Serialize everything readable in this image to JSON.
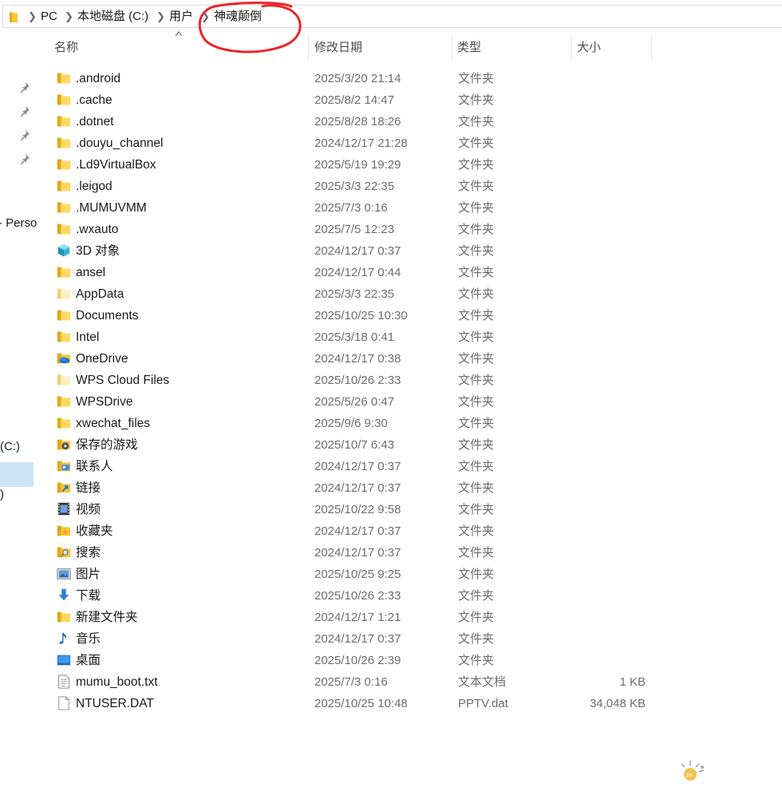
{
  "address": {
    "crumbs": [
      "PC",
      "本地磁盘 (C:)",
      "用户",
      "神魂颠倒"
    ]
  },
  "annotation": {
    "color": "#e8262b"
  },
  "nav": {
    "fragments": [
      "- Perso",
      "(C:)",
      ")"
    ],
    "pins": 4
  },
  "header": {
    "name": "名称",
    "date": "修改日期",
    "type": "类型",
    "size": "大小"
  },
  "files": [
    {
      "icon": "folder-icon",
      "name": ".android",
      "date": "2025/3/20 21:14",
      "type": "文件夹",
      "size": ""
    },
    {
      "icon": "folder-icon",
      "name": ".cache",
      "date": "2025/8/2 14:47",
      "type": "文件夹",
      "size": ""
    },
    {
      "icon": "folder-icon",
      "name": ".dotnet",
      "date": "2025/8/28 18:26",
      "type": "文件夹",
      "size": ""
    },
    {
      "icon": "folder-icon",
      "name": ".douyu_channel",
      "date": "2024/12/17 21:28",
      "type": "文件夹",
      "size": ""
    },
    {
      "icon": "folder-icon",
      "name": ".Ld9VirtualBox",
      "date": "2025/5/19 19:29",
      "type": "文件夹",
      "size": ""
    },
    {
      "icon": "folder-icon",
      "name": ".leigod",
      "date": "2025/3/3 22:35",
      "type": "文件夹",
      "size": ""
    },
    {
      "icon": "folder-icon",
      "name": ".MUMUVMM",
      "date": "2025/7/3 0:16",
      "type": "文件夹",
      "size": ""
    },
    {
      "icon": "folder-icon",
      "name": ".wxauto",
      "date": "2025/7/5 12:23",
      "type": "文件夹",
      "size": ""
    },
    {
      "icon": "3d-objects-icon",
      "name": "3D 对象",
      "date": "2024/12/17 0:37",
      "type": "文件夹",
      "size": ""
    },
    {
      "icon": "folder-icon",
      "name": "ansel",
      "date": "2024/12/17 0:44",
      "type": "文件夹",
      "size": ""
    },
    {
      "icon": "folder-light-icon",
      "name": "AppData",
      "date": "2025/3/3 22:35",
      "type": "文件夹",
      "size": ""
    },
    {
      "icon": "folder-icon",
      "name": "Documents",
      "date": "2025/10/25 10:30",
      "type": "文件夹",
      "size": ""
    },
    {
      "icon": "folder-icon",
      "name": "Intel",
      "date": "2025/3/18 0:41",
      "type": "文件夹",
      "size": ""
    },
    {
      "icon": "onedrive-folder-icon",
      "name": "OneDrive",
      "date": "2024/12/17 0:38",
      "type": "文件夹",
      "size": ""
    },
    {
      "icon": "folder-light-icon",
      "name": "WPS Cloud Files",
      "date": "2025/10/26 2:33",
      "type": "文件夹",
      "size": ""
    },
    {
      "icon": "folder-icon",
      "name": "WPSDrive",
      "date": "2025/5/26 0:47",
      "type": "文件夹",
      "size": ""
    },
    {
      "icon": "folder-icon",
      "name": "xwechat_files",
      "date": "2025/9/6 9:30",
      "type": "文件夹",
      "size": ""
    },
    {
      "icon": "saved-games-icon",
      "name": "保存的游戏",
      "date": "2025/10/7 6:43",
      "type": "文件夹",
      "size": ""
    },
    {
      "icon": "contacts-icon",
      "name": "联系人",
      "date": "2024/12/17 0:37",
      "type": "文件夹",
      "size": ""
    },
    {
      "icon": "links-icon",
      "name": "链接",
      "date": "2024/12/17 0:37",
      "type": "文件夹",
      "size": ""
    },
    {
      "icon": "videos-icon",
      "name": "视频",
      "date": "2025/10/22 9:58",
      "type": "文件夹",
      "size": ""
    },
    {
      "icon": "favorites-icon",
      "name": "收藏夹",
      "date": "2024/12/17 0:37",
      "type": "文件夹",
      "size": ""
    },
    {
      "icon": "searches-icon",
      "name": "搜索",
      "date": "2024/12/17 0:37",
      "type": "文件夹",
      "size": ""
    },
    {
      "icon": "pictures-icon",
      "name": "图片",
      "date": "2025/10/25 9:25",
      "type": "文件夹",
      "size": ""
    },
    {
      "icon": "downloads-icon",
      "name": "下载",
      "date": "2025/10/26 2:33",
      "type": "文件夹",
      "size": ""
    },
    {
      "icon": "folder-icon",
      "name": "新建文件夹",
      "date": "2024/12/17 1:21",
      "type": "文件夹",
      "size": ""
    },
    {
      "icon": "music-icon",
      "name": "音乐",
      "date": "2024/12/17 0:37",
      "type": "文件夹",
      "size": ""
    },
    {
      "icon": "desktop-icon",
      "name": "桌面",
      "date": "2025/10/26 2:39",
      "type": "文件夹",
      "size": ""
    },
    {
      "icon": "text-file-icon",
      "name": "mumu_boot.txt",
      "date": "2025/7/3 0:16",
      "type": "文本文档",
      "size": "1 KB"
    },
    {
      "icon": "file-icon",
      "name": "NTUSER.DAT",
      "date": "2025/10/25 10:48",
      "type": "PPTV.dat",
      "size": "34,048 KB"
    }
  ]
}
